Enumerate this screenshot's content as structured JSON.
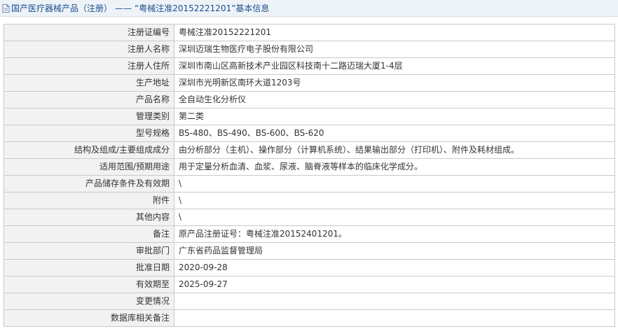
{
  "header": {
    "category": "国产医疗器械产品（注册）",
    "separator": "——",
    "record_title": "“粤械注准20152221201”基本信息",
    "icon": "document-icon"
  },
  "rows": [
    {
      "label": "注册证编号",
      "value": "粤械注准20152221201"
    },
    {
      "label": "注册人名称",
      "value": "深圳迈瑞生物医疗电子股份有限公司"
    },
    {
      "label": "注册人住所",
      "value": "深圳市南山区高新技术产业园区科技南十二路迈瑞大厦1-4层"
    },
    {
      "label": "生产地址",
      "value": "深圳市光明新区南环大道1203号"
    },
    {
      "label": "产品名称",
      "value": "全自动生化分析仪"
    },
    {
      "label": "管理类别",
      "value": "第二类"
    },
    {
      "label": "型号规格",
      "value": "BS-480、BS-490、BS-600、BS-620"
    },
    {
      "label": "结构及组成/主要组成成分",
      "value": "由分析部分（主机）、操作部分（计算机系统）、结果输出部分（打印机）、附件及耗材组成。"
    },
    {
      "label": "适用范围/预期用途",
      "value": "用于定量分析血清、血浆、尿液、脑脊液等样本的临床化学成分。"
    },
    {
      "label": "产品储存条件及有效期",
      "value": "\\"
    },
    {
      "label": "附件",
      "value": "\\"
    },
    {
      "label": "其他内容",
      "value": "\\"
    },
    {
      "label": "备注",
      "value": "原产品注册证号：粤械注准20152401201。"
    },
    {
      "label": "审批部门",
      "value": "广东省药品监督管理局"
    },
    {
      "label": "批准日期",
      "value": "2020-09-28"
    },
    {
      "label": "有效期至",
      "value": "2025-09-27"
    },
    {
      "label": "变更情况",
      "value": ""
    },
    {
      "label": "数据库相关备注",
      "value": ""
    }
  ]
}
